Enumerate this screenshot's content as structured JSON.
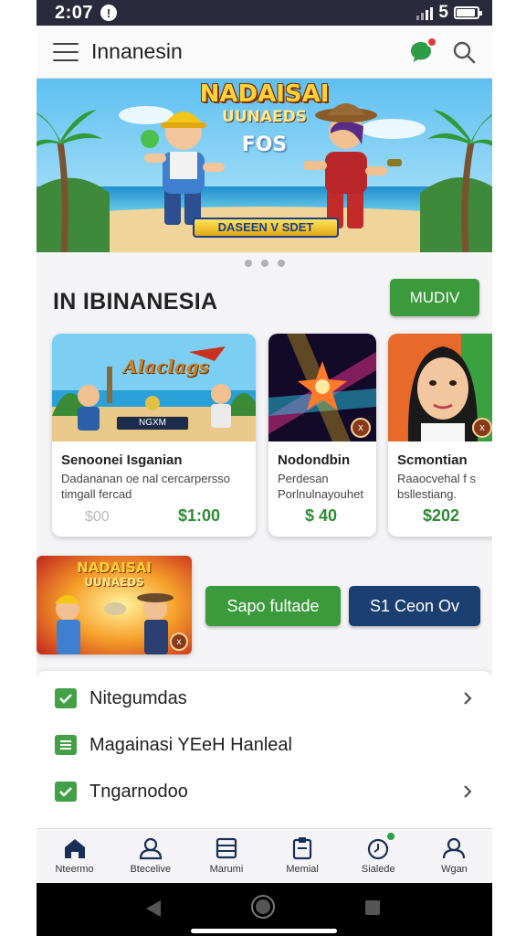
{
  "status_bar": {
    "time": "2:07",
    "alert_glyph": "!",
    "battery_text": "5",
    "battery_level_percent": 90
  },
  "app_bar": {
    "title": "Innanesin",
    "icons": [
      "menu-icon",
      "chat-icon",
      "search-icon"
    ]
  },
  "banner": {
    "title": "NADAISAI",
    "subtitle": "UUNAEDS",
    "tagline": "FOS",
    "button_label": "DASEEN V SDET",
    "carousel_dots": 3
  },
  "section": {
    "title": "IN IBINANESIA",
    "view_button": "MUDIV"
  },
  "cards": [
    {
      "image_text": "Alaclags",
      "image_button": "NGXM",
      "name": "Senoonei Isganian",
      "description": "Dadananan oe nal cercarpersso timgall fercad",
      "old_price": "$00",
      "price": "$1:00"
    },
    {
      "name": "Nodondbin",
      "description": "Perdesan Porlnulnayouhet",
      "price": "$ 40",
      "badge": "x"
    },
    {
      "name": "Scmontian",
      "description": "Raaocvehal f s bsllestiang.",
      "price": "$202",
      "badge": "x"
    }
  ],
  "promo": {
    "image_title_line1": "NADAISAI",
    "image_title_line2": "UUNAEDS",
    "badge": "x",
    "green_button": "Sapo fultade",
    "navy_button": "S1 Ceon Ov"
  },
  "list": [
    {
      "label": "Nitegumdas",
      "icon": "checkbox-icon",
      "has_chevron": true
    },
    {
      "label": "Magainasi YEeH Hanleal",
      "icon": "list-icon",
      "has_chevron": false
    },
    {
      "label": "Tngarnodoo",
      "icon": "checkbox-icon",
      "has_chevron": true
    }
  ],
  "bottom_nav": [
    {
      "label": "Nteermo",
      "icon": "home-icon"
    },
    {
      "label": "Btecelive",
      "icon": "user-icon"
    },
    {
      "label": "Marumi",
      "icon": "list-icon"
    },
    {
      "label": "Memial",
      "icon": "clipboard-icon"
    },
    {
      "label": "Sialede",
      "icon": "clock-icon"
    },
    {
      "label": "Wgan",
      "icon": "profile-icon"
    }
  ],
  "colors": {
    "accent_green": "#3a9a3c",
    "navy": "#1b3f70",
    "status_bar": "#2a2a3c",
    "price_green": "#2e8b34"
  }
}
